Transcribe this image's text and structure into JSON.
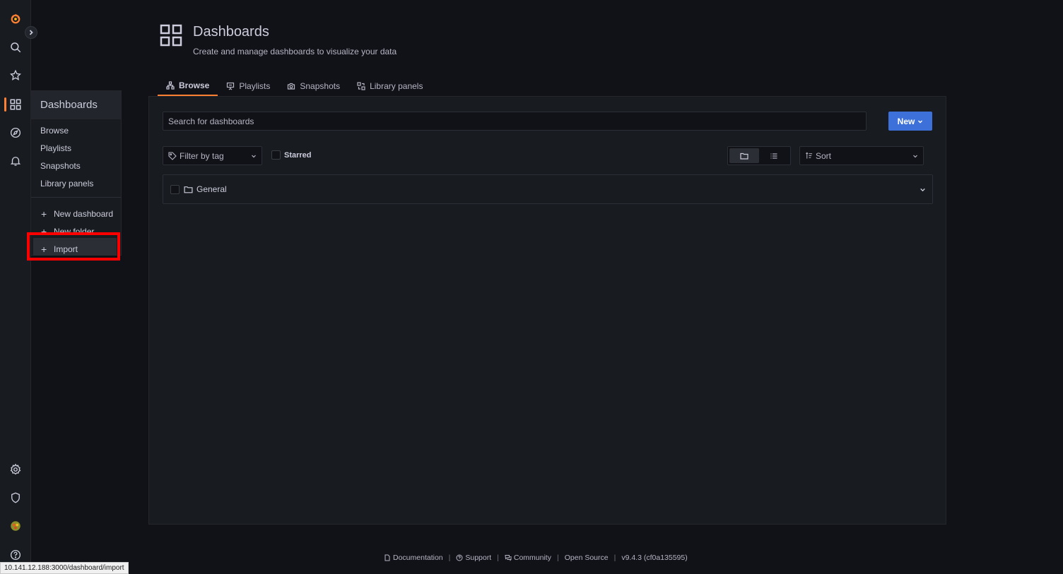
{
  "sidemenu": {
    "icons": [
      "grafana-logo-icon",
      "search-icon",
      "star-icon",
      "dashboards-icon",
      "explore-icon",
      "alerting-icon",
      "configuration-icon",
      "server-admin-icon",
      "avatar-icon",
      "help-icon"
    ],
    "accent": "#ff7f33"
  },
  "dropdown": {
    "header": "Dashboards",
    "items": [
      {
        "label": "Browse"
      },
      {
        "label": "Playlists"
      },
      {
        "label": "Snapshots"
      },
      {
        "label": "Library panels"
      }
    ],
    "actions": [
      {
        "label": "New dashboard"
      },
      {
        "label": "New folder"
      },
      {
        "label": "Import"
      }
    ]
  },
  "page": {
    "title": "Dashboards",
    "subtitle": "Create and manage dashboards to visualize your data"
  },
  "tabs": [
    {
      "label": "Browse",
      "icon": "sitemap-icon",
      "active": true
    },
    {
      "label": "Playlists",
      "icon": "presentation-icon",
      "active": false
    },
    {
      "label": "Snapshots",
      "icon": "camera-icon",
      "active": false
    },
    {
      "label": "Library panels",
      "icon": "library-panel-icon",
      "active": false
    }
  ],
  "browse": {
    "search_placeholder": "Search for dashboards",
    "new_button": "New",
    "new_button_color": "#3d71d9",
    "filter_placeholder": "Filter by tag",
    "starred_label": "Starred",
    "sort_placeholder": "Sort",
    "folders": [
      {
        "name": "General"
      }
    ]
  },
  "footer": {
    "links": [
      "Documentation",
      "Support",
      "Community",
      "Open Source",
      "v9.4.3 (cf0a135595)"
    ]
  },
  "statusbar": {
    "url": "10.141.12.188:3000/dashboard/import"
  }
}
